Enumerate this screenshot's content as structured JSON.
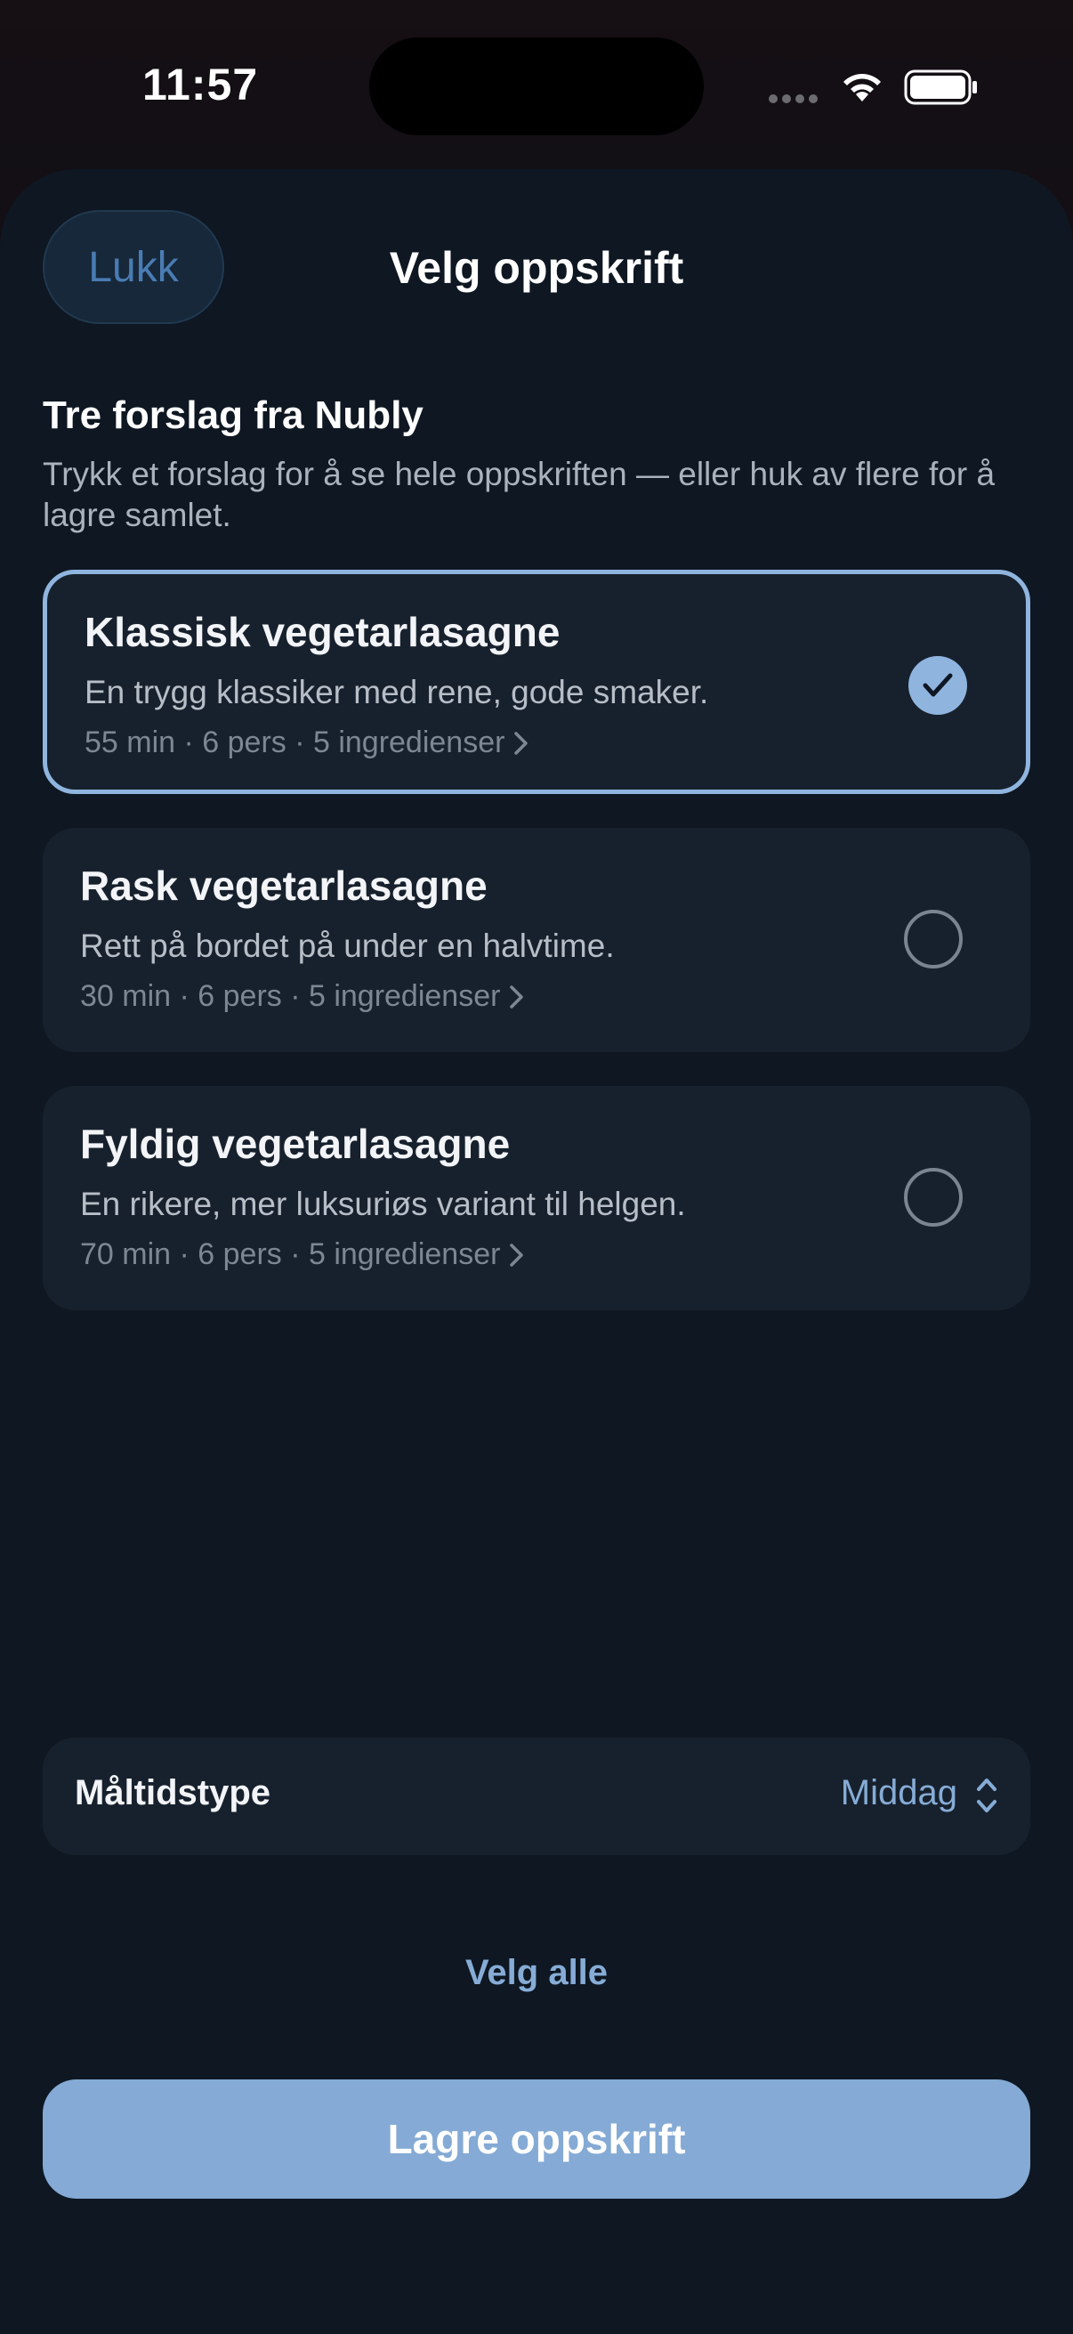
{
  "status_bar": {
    "time": "11:57"
  },
  "header": {
    "close_label": "Lukk",
    "title": "Velg oppskrift"
  },
  "intro": {
    "title": "Tre forslag fra Nubly",
    "subtitle": "Trykk et forslag for å se hele oppskriften — eller huk av flere for å lagre samlet."
  },
  "recipes": [
    {
      "title": "Klassisk vegetarlasagne",
      "description": "En trygg klassiker med rene, gode smaker.",
      "meta": "55 min · 6 pers · 5 ingredienser",
      "selected": true
    },
    {
      "title": "Rask vegetarlasagne",
      "description": "Rett på bordet på under en halvtime.",
      "meta": "30 min · 6 pers · 5 ingredienser",
      "selected": false
    },
    {
      "title": "Fyldig vegetarlasagne",
      "description": "En rikere, mer luksuriøs variant til helgen.",
      "meta": "70 min · 6 pers · 5 ingredienser",
      "selected": false
    }
  ],
  "meal_type": {
    "label": "Måltidstype",
    "value": "Middag"
  },
  "actions": {
    "select_all": "Velg alle",
    "save": "Lagre oppskrift"
  },
  "colors": {
    "accent": "#84aad5",
    "background": "#0e1722",
    "card": "#17212d"
  }
}
